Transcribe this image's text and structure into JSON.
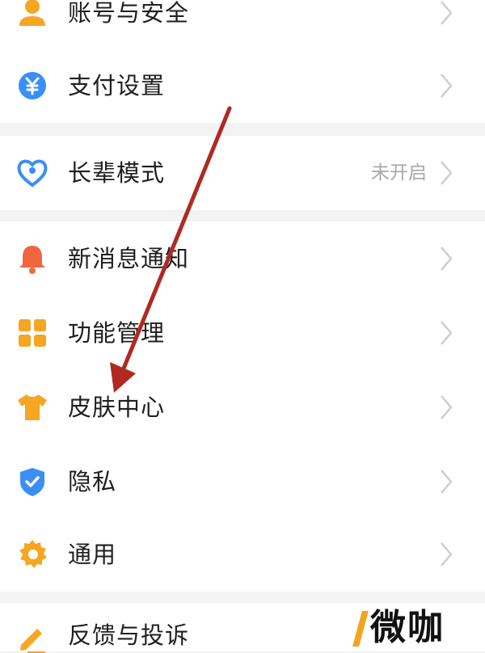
{
  "settings": {
    "account_security": "账号与安全",
    "payment_settings": "支付设置",
    "elder_mode": "长辈模式",
    "elder_mode_status": "未开启",
    "notifications": "新消息通知",
    "feature_management": "功能管理",
    "skin_center": "皮肤中心",
    "privacy": "隐私",
    "general": "通用",
    "feedback": "反馈与投诉"
  },
  "watermark": {
    "text": "微咖"
  },
  "colors": {
    "account_icon": "#f5a623",
    "payment_icon": "#3a8ef6",
    "elder_icon": "#3a8ef6",
    "notification_icon": "#f0673f",
    "feature_icon": "#f5a623",
    "skin_icon": "#f5a623",
    "privacy_icon": "#3a8ef6",
    "general_icon": "#f5a623",
    "feedback_icon": "#f5a623",
    "annotation_arrow": "#b02a22"
  },
  "icons": [
    "person-icon",
    "yen-icon",
    "heart-icon",
    "bell-icon",
    "grid-icon",
    "tshirt-icon",
    "shield-icon",
    "gear-icon",
    "pencil-icon",
    "chevron-right-icon"
  ]
}
